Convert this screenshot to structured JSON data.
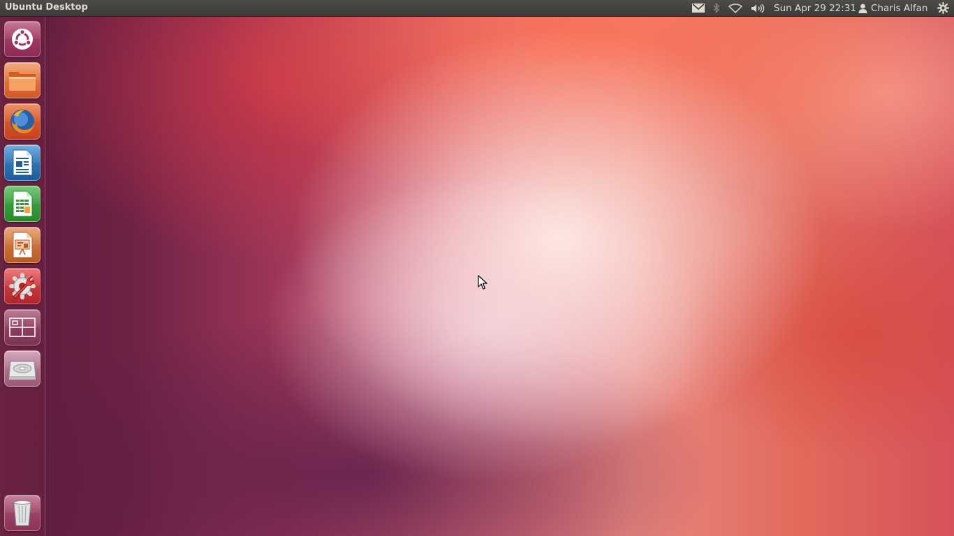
{
  "panel": {
    "title": "Ubuntu Desktop",
    "clock": "Sun Apr 29 22:31",
    "user_name": "Charis Alfan",
    "indicators": [
      "mail-icon",
      "bluetooth-icon",
      "wifi-icon",
      "volume-icon",
      "user-icon",
      "session-gear-icon"
    ]
  },
  "launcher": {
    "items": [
      {
        "name": "dash-home",
        "icon": "ubuntu-logo-icon"
      },
      {
        "name": "files",
        "icon": "folder-icon"
      },
      {
        "name": "firefox",
        "icon": "firefox-icon"
      },
      {
        "name": "libreoffice-writer",
        "icon": "writer-document-icon"
      },
      {
        "name": "libreoffice-calc",
        "icon": "calc-spreadsheet-icon"
      },
      {
        "name": "libreoffice-impress",
        "icon": "impress-presentation-icon"
      },
      {
        "name": "system-settings",
        "icon": "settings-wrench-gear-icon"
      },
      {
        "name": "workspace-switcher",
        "icon": "workspaces-icon"
      },
      {
        "name": "drive",
        "icon": "hard-drive-icon"
      },
      {
        "name": "trash",
        "icon": "trash-icon"
      }
    ]
  },
  "colors": {
    "panel_background": "#3c3b37",
    "panel_text": "#dfdbd2",
    "wallpaper_accent": "#e9877f"
  }
}
